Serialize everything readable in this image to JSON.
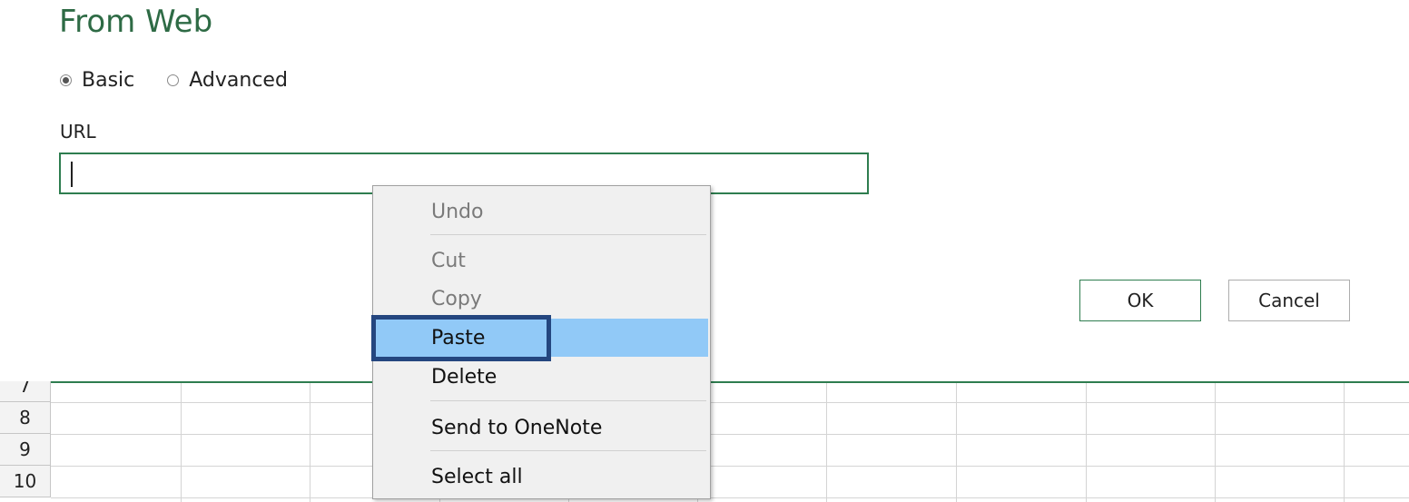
{
  "dialog": {
    "title": "From Web",
    "mode_options": [
      {
        "label": "Basic",
        "selected": true
      },
      {
        "label": "Advanced",
        "selected": false
      }
    ],
    "url_label": "URL",
    "url_value": "",
    "ok_label": "OK",
    "cancel_label": "Cancel"
  },
  "context_menu": {
    "items": [
      {
        "label": "Undo",
        "enabled": false
      },
      {
        "label": "Cut",
        "enabled": false
      },
      {
        "label": "Copy",
        "enabled": false
      },
      {
        "label": "Paste",
        "enabled": true,
        "highlighted": true
      },
      {
        "label": "Delete",
        "enabled": true
      },
      {
        "label": "Send to OneNote",
        "enabled": true
      },
      {
        "label": "Select all",
        "enabled": true
      }
    ]
  },
  "sheet": {
    "row_numbers": [
      "7",
      "8",
      "9",
      "10"
    ]
  },
  "colors": {
    "accent_green": "#2e7d4f",
    "title_green": "#2e6b45",
    "menu_highlight": "#91c9f7",
    "annotation_box": "#24467f"
  }
}
